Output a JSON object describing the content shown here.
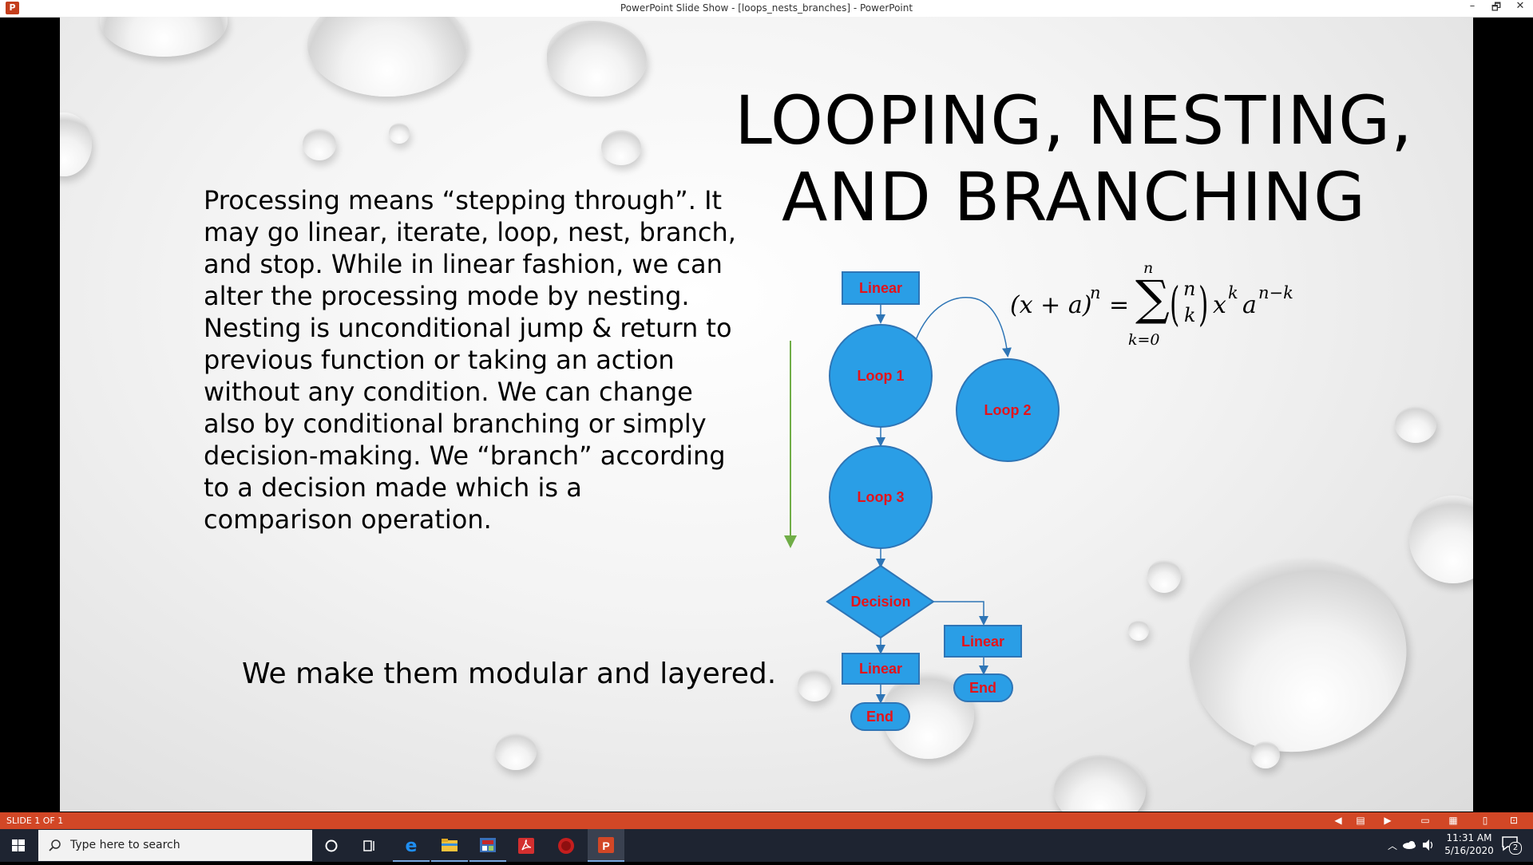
{
  "window": {
    "title": "PowerPoint Slide Show - [loops_nests_branches] - PowerPoint",
    "app_icon_letter": "P",
    "controls": [
      "–",
      "🗗",
      "✕"
    ]
  },
  "slide": {
    "title_line1": "LOOPING, NESTING,",
    "title_line2": "AND BRANCHING",
    "body": "Processing means “stepping through”. It may go linear, iterate, loop, nest, branch, and stop. While in linear fashion, we can alter the processing mode by nesting. Nesting is unconditional jump & return to previous function or taking an action without any condition. We can change also by conditional branching or simply decision-making. We “branch” according to a decision made which is a comparison operation.",
    "subtext": "We make them modular and layered.",
    "formula": {
      "lhs": "(x + a)",
      "lhs_exp": "n",
      "equals": "=",
      "sigma": "∑",
      "sum_upper": "n",
      "sum_lower": "k=0",
      "binom_top": "n",
      "binom_bottom": "k",
      "term": "x",
      "term_exp": "k",
      "term2": "a",
      "term2_exp": "n−k"
    },
    "flowchart": {
      "fill_color": "#2a9ee6",
      "stroke_color": "#2e75b6",
      "text_color": "#e4131a",
      "side_arrow_color": "#70ad47",
      "linear_top": "Linear",
      "loop1": "Loop 1",
      "loop2": "Loop 2",
      "loop3": "Loop 3",
      "decision": "Decision",
      "linear_left": "Linear",
      "linear_right": "Linear",
      "end_left": "End",
      "end_right": "End"
    }
  },
  "statusbar": {
    "slide_counter": "SLIDE 1 OF 1",
    "color": "#d24726"
  },
  "taskbar": {
    "search_placeholder": "Type here to search",
    "time": "11:31 AM",
    "date": "5/16/2020",
    "notification_count": "2"
  }
}
